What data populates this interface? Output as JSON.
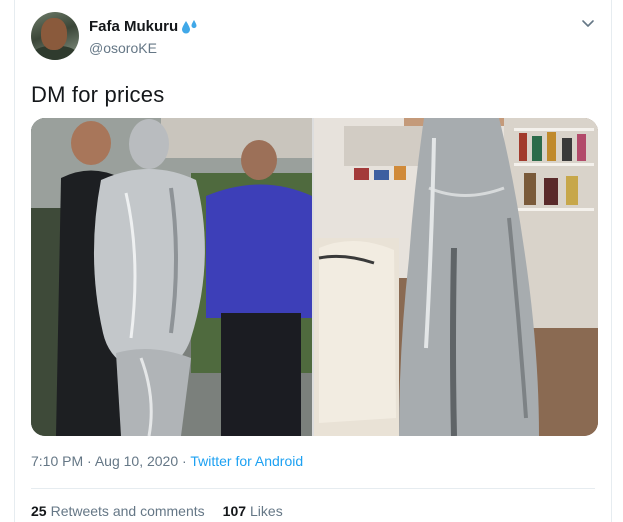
{
  "tweet": {
    "display_name": "Fafa Mukuru",
    "name_emoji_icon": "sweat-droplets-icon",
    "handle": "@osoroKE",
    "text": "DM for prices",
    "time": "7:10 PM",
    "separator": "·",
    "date": "Aug 10, 2020",
    "source": "Twitter for Android"
  },
  "stats": {
    "retweets_count": "25",
    "retweets_label": "Retweets and comments",
    "likes_count": "107",
    "likes_label": "Likes"
  },
  "colors": {
    "link": "#1da1f2",
    "secondary_text": "#657786",
    "primary_text": "#14171a"
  }
}
